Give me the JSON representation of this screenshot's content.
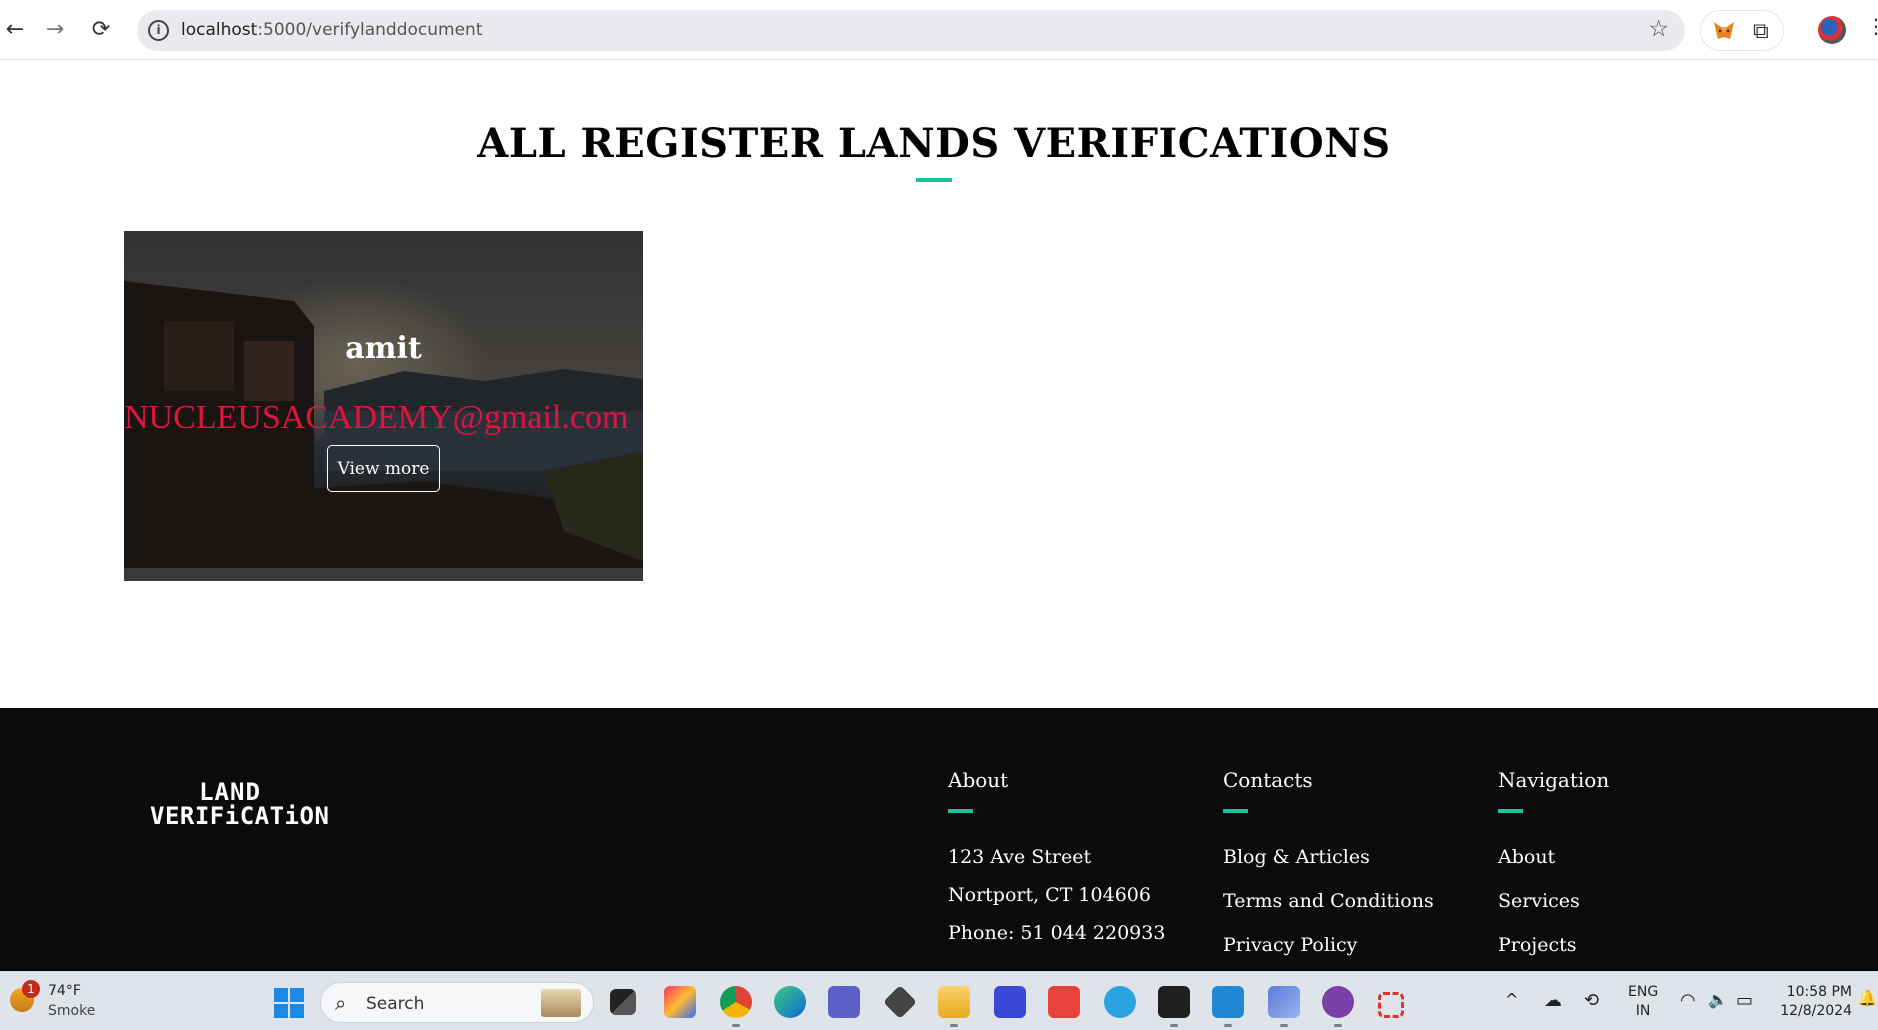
{
  "browser": {
    "url_host": "localhost",
    "url_path": ":5000/verifylanddocument",
    "back_icon": "←",
    "forward_icon": "→",
    "reload_icon": "⟳",
    "info_icon": "i",
    "star_icon": "☆",
    "puzzle_icon": "⧉",
    "menu_icon": "⋮"
  },
  "page": {
    "title": "ALL REGISTER LANDS VERIFICATIONS",
    "accent_color": "#19c39b"
  },
  "cards": [
    {
      "owner": "amit",
      "email": "NUCLEUSACADEMY@gmail.com",
      "button_label": "View more"
    }
  ],
  "footer": {
    "logo_line1": "LAND",
    "logo_line2": "VERIFiCATiON",
    "about": {
      "heading": "About",
      "lines": [
        "123 Ave Street",
        "Nortport, CT 104606",
        "Phone: 51 044 220933"
      ]
    },
    "contacts": {
      "heading": "Contacts",
      "links": [
        "Blog & Articles",
        "Terms and Conditions",
        "Privacy Policy"
      ]
    },
    "navigation": {
      "heading": "Navigation",
      "links": [
        "About",
        "Services",
        "Projects"
      ]
    }
  },
  "taskbar": {
    "weather_badge": "1",
    "weather_temp": "74°F",
    "weather_desc": "Smoke",
    "search_label": "Search",
    "search_icon": "⌕",
    "tray_chevron": "^",
    "lang_line1": "ENG",
    "lang_line2": "IN",
    "time": "10:58 PM",
    "date": "12/8/2024",
    "wifi_icon": "◠",
    "volume_icon": "🔈",
    "battery_icon": "▭",
    "bell_icon": "🔔"
  }
}
